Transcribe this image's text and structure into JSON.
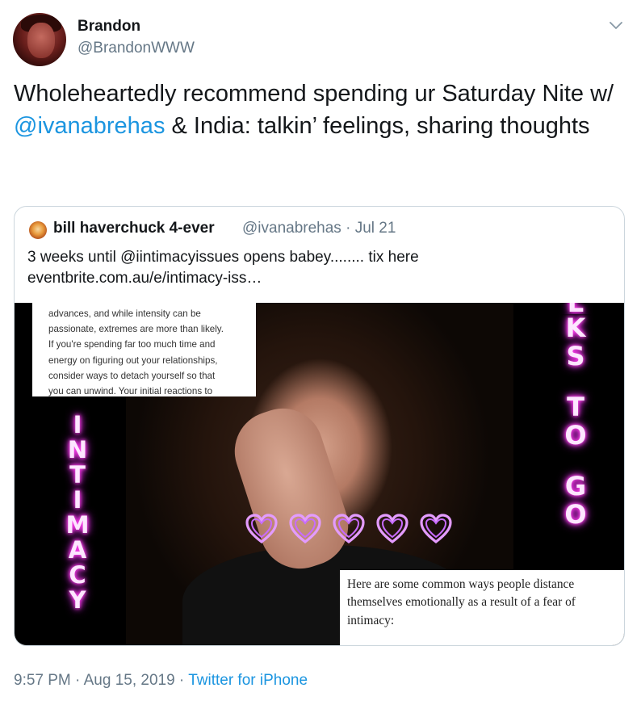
{
  "author": {
    "name": "Brandon",
    "handle": "@BrandonWWW"
  },
  "tweet": {
    "text_part1": "Wholeheartedly recommend spending ur Saturday Nite w/ ",
    "mention": "@ivanabrehas",
    "text_part2": " & India: talkin’ feelings, sharing thoughts"
  },
  "quote": {
    "name": "bill haverchuck 4-ever",
    "handle": "@ivanabrehas",
    "separator": "·",
    "date": "Jul 21",
    "text_line1": "3 weeks until @iintimacyissues opens babey........  tix here",
    "text_line2": "eventbrite.com.au/e/intimacy-iss…",
    "media": {
      "clip_top_lines": [
        "advances, and while intensity can be",
        "passionate, extremes are more than likely.",
        "If you're spending far too much time and",
        "energy on figuring out your relationships,",
        "consider ways to detach yourself so that",
        "you can unwind. Your initial reactions to"
      ],
      "neon_left": [
        "I",
        "N",
        "T",
        "I",
        "M",
        "A",
        "C",
        "Y"
      ],
      "neon_right": [
        "K",
        "S",
        "",
        "T",
        "O",
        "",
        "G",
        "O"
      ],
      "neon_right_partial": "L",
      "clip_bottom_lines": [
        "Here are some common ways people distance",
        "themselves emotionally as a result of a fear of",
        "intimacy:"
      ],
      "neon_color": "#ff4cf0",
      "heart_icon": "heart-outline-icon"
    }
  },
  "meta": {
    "time": "9:57 PM",
    "sep1": " · ",
    "date": "Aug 15, 2019",
    "sep2": " · ",
    "source": "Twitter for iPhone"
  },
  "colors": {
    "link": "#1b95e0",
    "secondary": "#657786",
    "text": "#14171a",
    "border": "#ccd6dd"
  }
}
